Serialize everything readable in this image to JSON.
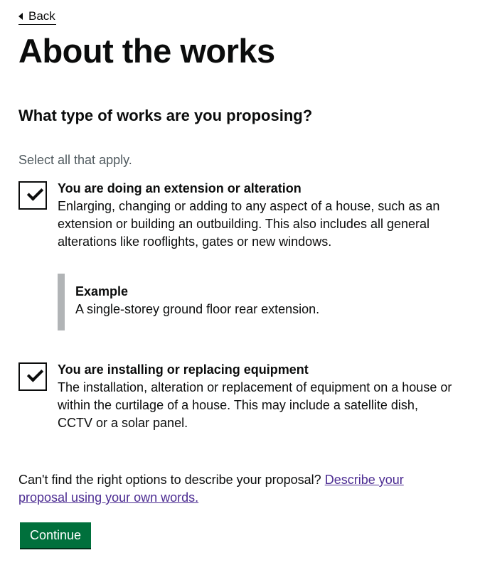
{
  "nav": {
    "back_label": "Back"
  },
  "page": {
    "title": "About the works"
  },
  "question": {
    "legend": "What type of works are you proposing?",
    "hint": "Select all that apply."
  },
  "options": [
    {
      "label": "You are doing an extension or alteration",
      "hint": "Enlarging, changing or adding to any aspect of a house, such as an extension or building an outbuilding. This also includes all general alterations like rooflights, gates or new windows.",
      "checked": true,
      "example": {
        "title": "Example",
        "text": "A single-storey ground floor rear extension."
      }
    },
    {
      "label": "You are installing or replacing equipment",
      "hint": "The installation, alteration or replacement of equipment on a house or within the curtilage of a house. This may include a satellite dish, CCTV or a solar panel.",
      "checked": true
    }
  ],
  "footer": {
    "prompt": "Can't find the right options to describe your proposal?",
    "link_text": "Describe your proposal using your own words."
  },
  "actions": {
    "continue_label": "Continue"
  },
  "colors": {
    "text": "#0b0c0c",
    "hint": "#505a5f",
    "button": "#00703c",
    "link_visited": "#4c2c92",
    "inset_border": "#b1b4b6"
  }
}
